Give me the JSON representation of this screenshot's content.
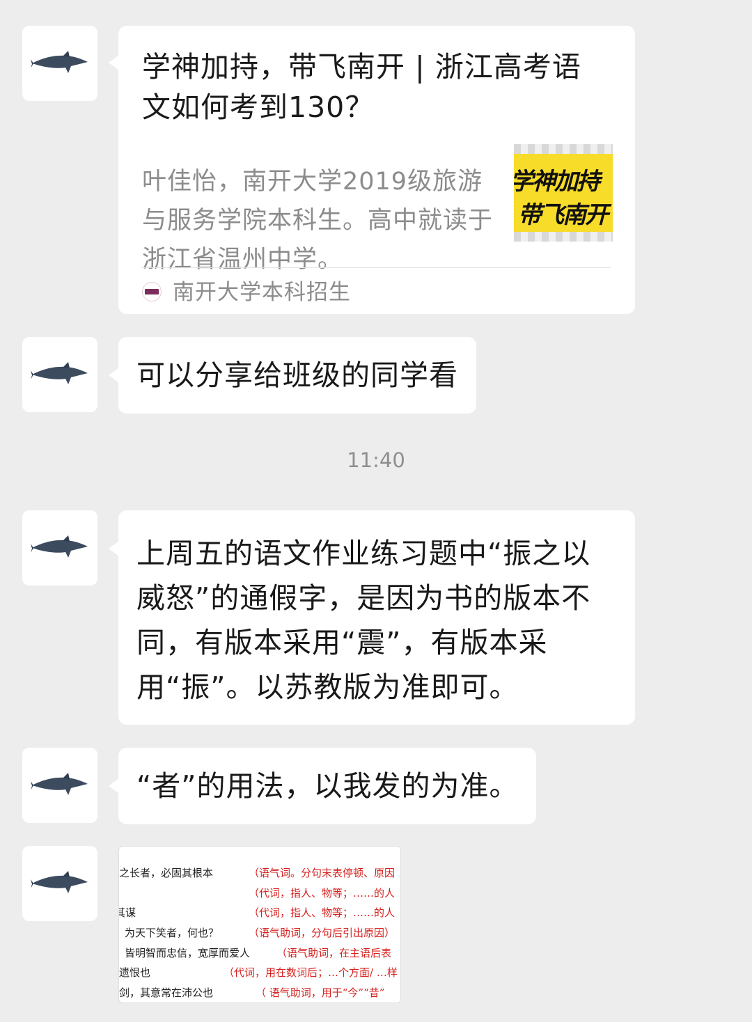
{
  "messages": {
    "card": {
      "title": "学神加持，带飞南开 | 浙江高考语文如何考到130？",
      "description": "叶佳怡，南开大学2019级旅游与服务学院本科生。高中就读于浙江省温州中学。",
      "thumbnail_line1": "学神加持",
      "thumbnail_line2": "带飞南开",
      "source": "南开大学本科招生"
    },
    "msg2": "可以分享给班级的同学看",
    "timestamp": "11:40",
    "msg3": "上周五的语文作业练习题中“振之以威怒”的通假字，是因为书的版本不同，有版本采用“震”，有版本采用“振”。以苏教版为准即可。",
    "msg4": "“者”的用法，以我发的为准。",
    "image_rows": [
      {
        "left": "之长者，必固其根本",
        "right": "（语气词。分句末表停顿、原因"
      },
      {
        "left": "",
        "right": "（代词，指人、物等；……的人"
      },
      {
        "left": "其谋",
        "right": "（代词，指人、物等；……的人"
      },
      {
        "left": "为天下笑者，何也？",
        "right": "（语气助词，分句后引出原因）"
      },
      {
        "left": "皆明智而忠信，宽厚而爱人",
        "right": "（语气助词，在主语后表"
      },
      {
        "left": "遗恨也",
        "right": "（代词，用在数词后；…个方面/ …样"
      },
      {
        "left": "剑，其意常在沛公也",
        "right": "（ 语气助词，用于“今”“昔”"
      }
    ]
  },
  "colors": {
    "background": "#ededed",
    "bubble": "#ffffff",
    "timestamp": "#8f8f8f",
    "annotation_red": "#d6201d",
    "thumbnail_yellow": "#f8dc2a"
  },
  "icons": {
    "avatar": "dolphin-avatar-icon",
    "source": "nankai-logo-icon"
  }
}
